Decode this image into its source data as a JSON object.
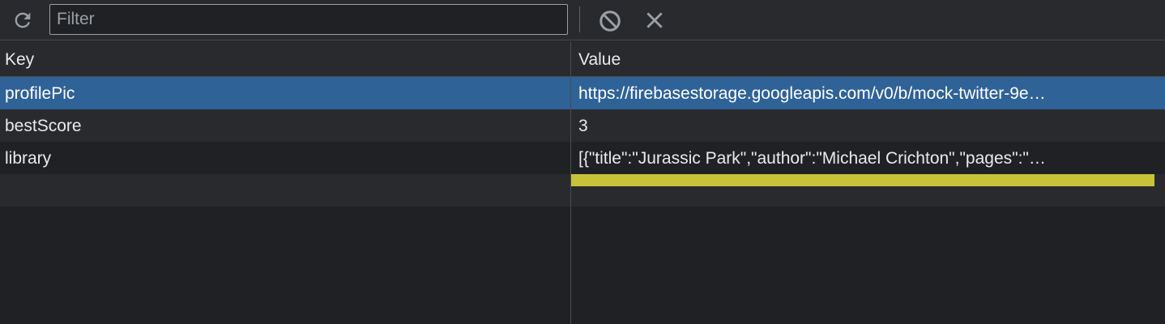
{
  "toolbar": {
    "filter_placeholder": "Filter",
    "refresh_icon": "refresh-icon",
    "block_icon": "block-icon",
    "clear_icon": "close-icon"
  },
  "table": {
    "headers": {
      "key": "Key",
      "value": "Value"
    },
    "rows": [
      {
        "key": "profilePic",
        "value": "https://firebasestorage.googleapis.com/v0/b/mock-twitter-9e…"
      },
      {
        "key": "bestScore",
        "value": "3"
      },
      {
        "key": "library",
        "value": "[{\"title\":\"Jurassic Park\",\"author\":\"Michael Crichton\",\"pages\":\"…"
      }
    ]
  },
  "colors": {
    "selected_row": "#2f6297",
    "highlight_bar": "#c8c23a",
    "background": "#202124"
  }
}
